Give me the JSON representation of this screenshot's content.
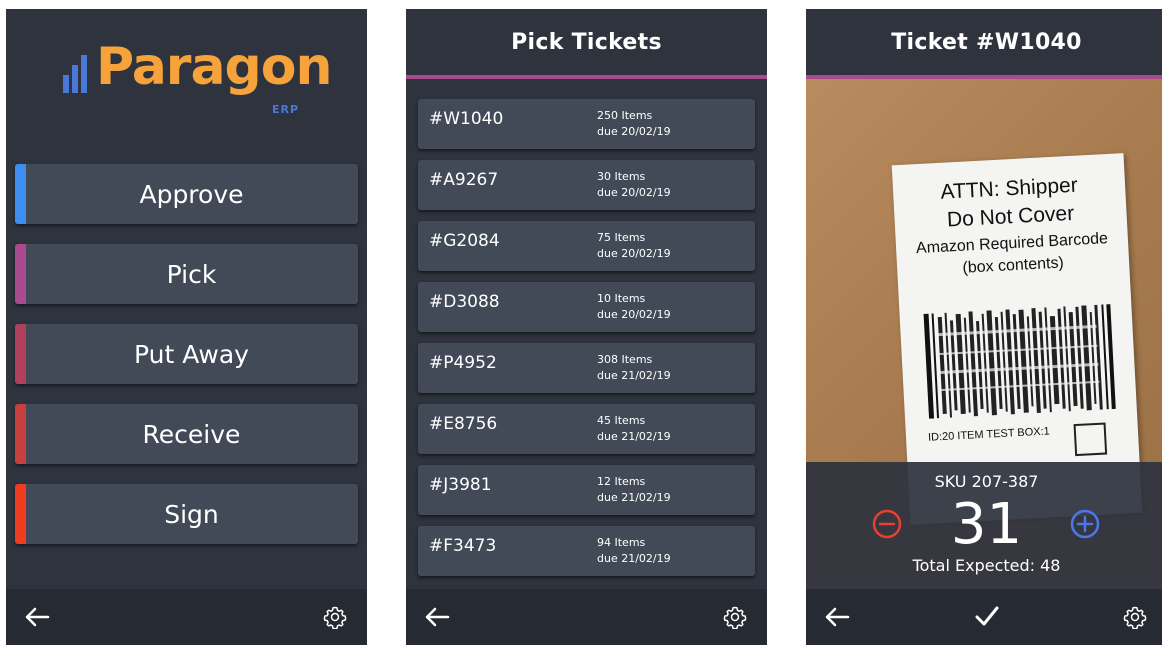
{
  "menu_screen": {
    "logo": {
      "name": "Paragon",
      "sub": "ERP"
    },
    "buttons": [
      {
        "label": "Approve",
        "accent": "#3d8ef0"
      },
      {
        "label": "Pick",
        "accent": "#a94a8e"
      },
      {
        "label": "Put Away",
        "accent": "#b0405c"
      },
      {
        "label": "Receive",
        "accent": "#c7403e"
      },
      {
        "label": "Sign",
        "accent": "#f03c1e"
      }
    ]
  },
  "tickets_screen": {
    "title": "Pick Tickets",
    "tickets": [
      {
        "id": "#W1040",
        "items": "250 Items",
        "due": "due 20/02/19"
      },
      {
        "id": "#A9267",
        "items": "30 Items",
        "due": "due 20/02/19"
      },
      {
        "id": "#G2084",
        "items": "75 Items",
        "due": "due 20/02/19"
      },
      {
        "id": "#D3088",
        "items": "10 Items",
        "due": "due 20/02/19"
      },
      {
        "id": "#P4952",
        "items": "308 Items",
        "due": "due 21/02/19"
      },
      {
        "id": "#E8756",
        "items": "45 Items",
        "due": "due 21/02/19"
      },
      {
        "id": "#J3981",
        "items": "12 Items",
        "due": "due 21/02/19"
      },
      {
        "id": "#F3473",
        "items": "94 Items",
        "due": "due 21/02/19"
      }
    ]
  },
  "ticket_screen": {
    "title": "Ticket #W1040",
    "photo_label": {
      "line1": "ATTN: Shipper",
      "line2": "Do Not Cover",
      "line3": "Amazon Required Barcode",
      "line4": "(box contents)",
      "footer": "ID:20 ITEM TEST   BOX:1"
    },
    "sku": "SKU 207-387",
    "count": "31",
    "total": "Total Expected: 48"
  },
  "icons": {
    "back": "arrow-left-icon",
    "settings": "gear-icon",
    "confirm": "checkmark-icon",
    "decrement": "minus-circle-icon",
    "increment": "plus-circle-icon"
  },
  "colors": {
    "background": "#2e333e",
    "card": "#424a58",
    "header_accent": "#a94a8e",
    "logo_orange": "#f5a33a",
    "logo_blue": "#4a78d8",
    "minus_red": "#e8402e",
    "plus_blue": "#4a78e8"
  }
}
